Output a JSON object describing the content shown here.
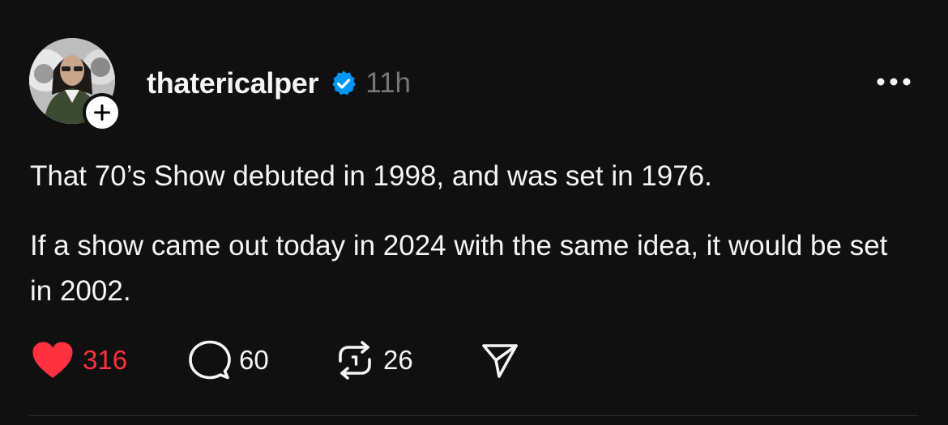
{
  "post": {
    "author": {
      "username": "thatericalper",
      "verified": true,
      "verified_icon": "verified-badge-icon",
      "avatar_icon": "avatar",
      "follow_icon": "plus-icon"
    },
    "timestamp": "11h",
    "more_icon": "more-icon",
    "text": {
      "paragraph1": "That 70’s Show debuted in 1998, and was set in 1976.",
      "paragraph2": "If a show came out today in 2024 with the same idea, it would be set in 2002."
    },
    "actions": {
      "like": {
        "icon": "heart-icon",
        "count": "316",
        "liked": true
      },
      "reply": {
        "icon": "comment-icon",
        "count": "60"
      },
      "repost": {
        "icon": "repost-icon",
        "count": "26"
      },
      "share": {
        "icon": "send-icon"
      }
    }
  },
  "colors": {
    "background": "#101010",
    "text": "#f3f5f7",
    "muted": "#777777",
    "like": "#ff3040",
    "verified": "#0095f6"
  }
}
